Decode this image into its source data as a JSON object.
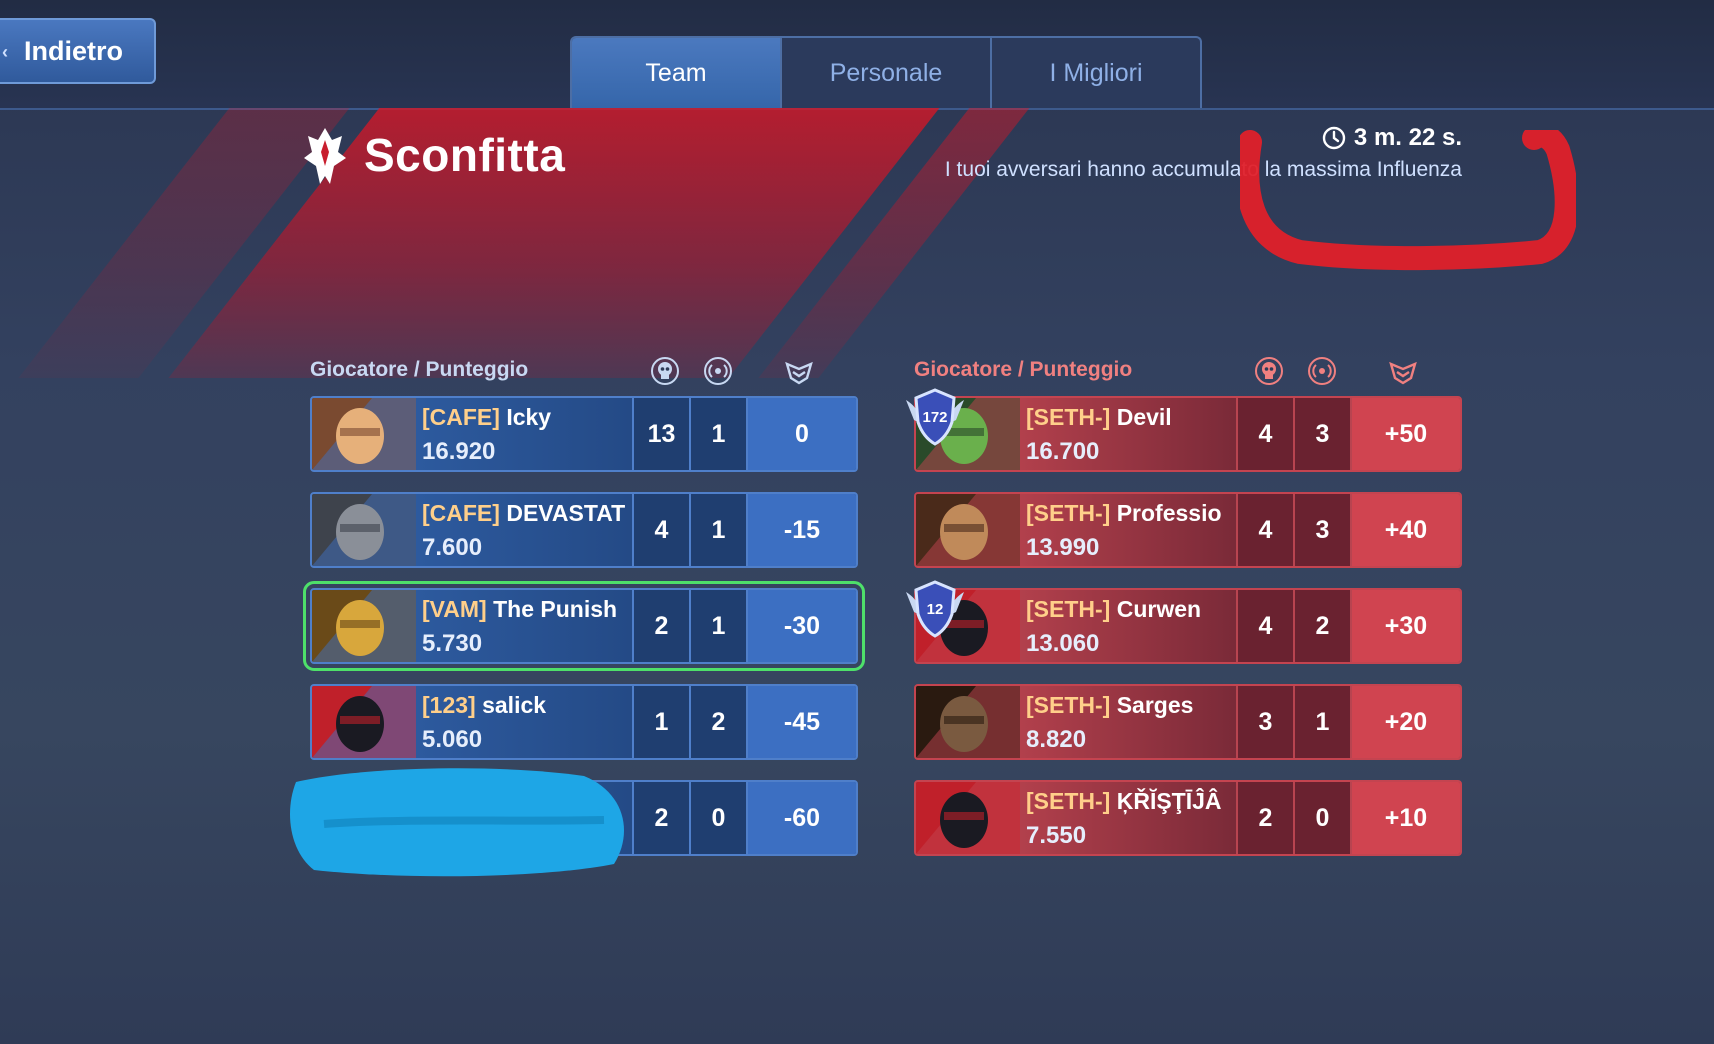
{
  "nav": {
    "back_label": "Indietro"
  },
  "tabs": [
    {
      "label": "Team",
      "active": true
    },
    {
      "label": "Personale",
      "active": false
    },
    {
      "label": "I Migliori",
      "active": false
    }
  ],
  "result": {
    "title": "Sconfitta",
    "timer": "3 m. 22 s.",
    "subtitle": "I tuoi avversari hanno accumulato la massima Influenza"
  },
  "colors": {
    "team_blue": "#3c6fc2",
    "enemy_red": "#d04450",
    "tag": "#ffcf8a",
    "self_outline": "#4ee06a"
  },
  "left_team": {
    "header": "Giocatore / Punteggio",
    "column_icons": [
      "skull-icon",
      "signal-icon",
      "crown-shield-icon"
    ],
    "players": [
      {
        "tag": "[CAFE]",
        "name": "Icky",
        "score": "16.920",
        "kills": "13",
        "assists": "1",
        "points": "0"
      },
      {
        "tag": "[CAFE]",
        "name": "DEVASTAT",
        "score": "7.600",
        "kills": "4",
        "assists": "1",
        "points": "-15"
      },
      {
        "tag": "[VAM]",
        "name": "The Punish",
        "score": "5.730",
        "kills": "2",
        "assists": "1",
        "points": "-30"
      },
      {
        "tag": "[123]",
        "name": "salick",
        "score": "5.060",
        "kills": "1",
        "assists": "2",
        "points": "-45"
      },
      {
        "tag": "",
        "name": "",
        "score": "",
        "kills": "2",
        "assists": "0",
        "points": "-60"
      }
    ]
  },
  "right_team": {
    "header": "Giocatore / Punteggio",
    "column_icons": [
      "skull-icon",
      "signal-icon",
      "crown-shield-icon"
    ],
    "players": [
      {
        "tag": "[SETH-]",
        "name": "Devil",
        "score": "16.700",
        "kills": "4",
        "assists": "3",
        "points": "+50",
        "level": "172"
      },
      {
        "tag": "[SETH-]",
        "name": "Professio",
        "score": "13.990",
        "kills": "4",
        "assists": "3",
        "points": "+40"
      },
      {
        "tag": "[SETH-]",
        "name": "Curwen",
        "score": "13.060",
        "kills": "4",
        "assists": "2",
        "points": "+30",
        "level": "12"
      },
      {
        "tag": "[SETH-]",
        "name": "Sarges",
        "score": "8.820",
        "kills": "3",
        "assists": "1",
        "points": "+20"
      },
      {
        "tag": "[SETH-]",
        "name": "ĶŘĬŞŢĪĴÂ",
        "score": "7.550",
        "kills": "2",
        "assists": "0",
        "points": "+10"
      }
    ]
  }
}
